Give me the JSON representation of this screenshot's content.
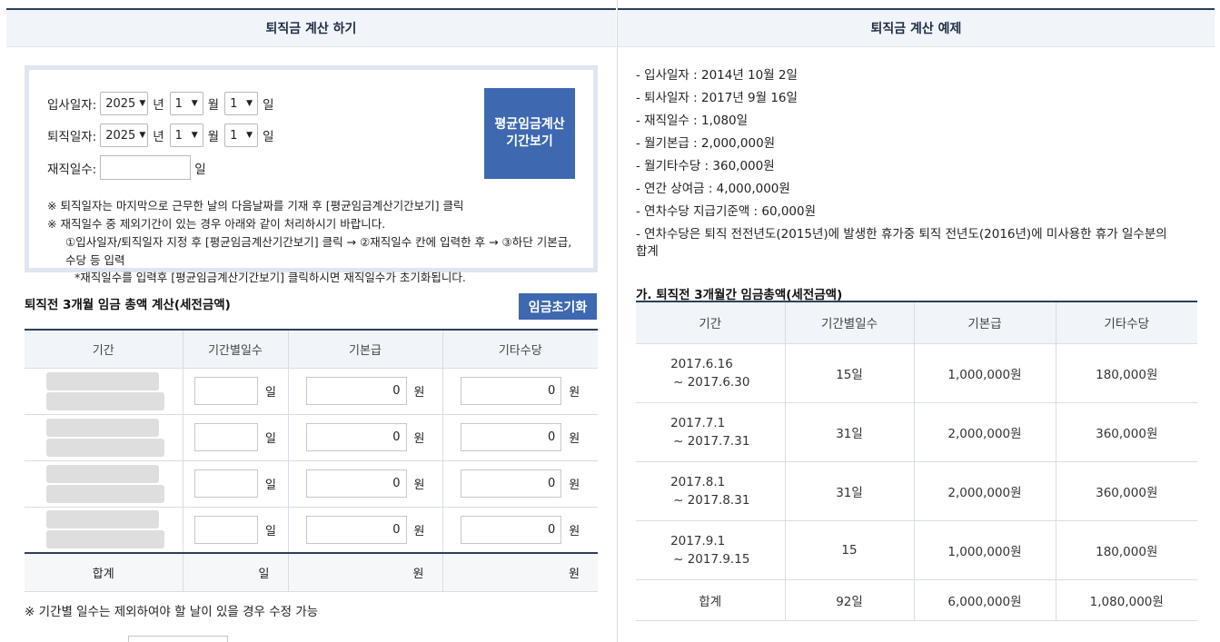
{
  "left": {
    "header": "퇴직금 계산 하기",
    "hire_label": "입사일자:",
    "retire_label": "퇴직일자:",
    "tenure_label": "재직일수:",
    "tenure_unit": "일",
    "year_unit": "년",
    "month_unit": "월",
    "day_unit": "일",
    "hire": {
      "year": "2025",
      "month": "1",
      "day": "1"
    },
    "retire": {
      "year": "2025",
      "month": "1",
      "day": "1"
    },
    "tenure_value": "",
    "period_button": "평균임금계산\n기간보기",
    "notes": [
      "※ 퇴직일자는 마지막으로 근무한 날의 다음날짜를 기재 후 [평균임금계산기간보기] 클릭",
      "※ 재직일수 중 제외기간이 있는 경우 아래와 같이 처리하시기 바랍니다.",
      "①입사일자/퇴직일자 지정 후 [평균임금계산기간보기] 클릭 → ②재직일수 칸에 입력한 후 → ③하단 기본급, 수당 등 입력",
      "*재직일수를 입력후 [평균임금계산기간보기] 클릭하시면 재직일수가 초기화됩니다."
    ],
    "section_title": "퇴직전 3개월 임금 총액 계산(세전금액)",
    "reset_button": "임금초기화",
    "columns": [
      "기간",
      "기간별일수",
      "기본급",
      "기타수당"
    ],
    "rows": [
      {
        "days": "",
        "days_unit": "일",
        "base": "0",
        "base_unit": "원",
        "other": "0",
        "other_unit": "원"
      },
      {
        "days": "",
        "days_unit": "일",
        "base": "0",
        "base_unit": "원",
        "other": "0",
        "other_unit": "원"
      },
      {
        "days": "",
        "days_unit": "일",
        "base": "0",
        "base_unit": "원",
        "other": "0",
        "other_unit": "원"
      },
      {
        "days": "",
        "days_unit": "일",
        "base": "0",
        "base_unit": "원",
        "other": "0",
        "other_unit": "원"
      }
    ],
    "sum": {
      "label": "합계",
      "days": "일",
      "base": "원",
      "other": "원"
    },
    "bottom_note": "※ 기간별 일수는 제외하여야 할 날이 있을 경우 수정 가능"
  },
  "right": {
    "header": "퇴직금 계산 예제",
    "items": [
      "- 입사일자 : 2014년 10월 2일",
      "- 퇴사일자 : 2017년 9월 16일",
      "- 재직일수 : 1,080일",
      "- 월기본급 : 2,000,000원",
      "- 월기타수당 : 360,000원",
      "- 연간 상여금 : 4,000,000원",
      "- 연차수당 지급기준액 : 60,000원",
      "- 연차수당은 퇴직 전전년도(2015년)에 발생한 휴가중 퇴직 전년도(2016년)에 미사용한 휴가 일수분의 합계"
    ],
    "table_title": "가. 퇴직전 3개월간 임금총액(세전금액)",
    "columns": [
      "기간",
      "기간별일수",
      "기본급",
      "기타수당"
    ],
    "rows": [
      {
        "start": "2017.6.16",
        "end": "~ 2017.6.30",
        "days": "15일",
        "base": "1,000,000원",
        "other": "180,000원"
      },
      {
        "start": "2017.7.1",
        "end": "~ 2017.7.31",
        "days": "31일",
        "base": "2,000,000원",
        "other": "360,000원"
      },
      {
        "start": "2017.8.1",
        "end": "~ 2017.8.31",
        "days": "31일",
        "base": "2,000,000원",
        "other": "360,000원"
      },
      {
        "start": "2017.9.1",
        "end": "~ 2017.9.15",
        "days": "15",
        "base": "1,000,000원",
        "other": "180,000원"
      }
    ],
    "sum": {
      "label": "합계",
      "days": "92일",
      "base": "6,000,000원",
      "other": "1,080,000원"
    }
  }
}
